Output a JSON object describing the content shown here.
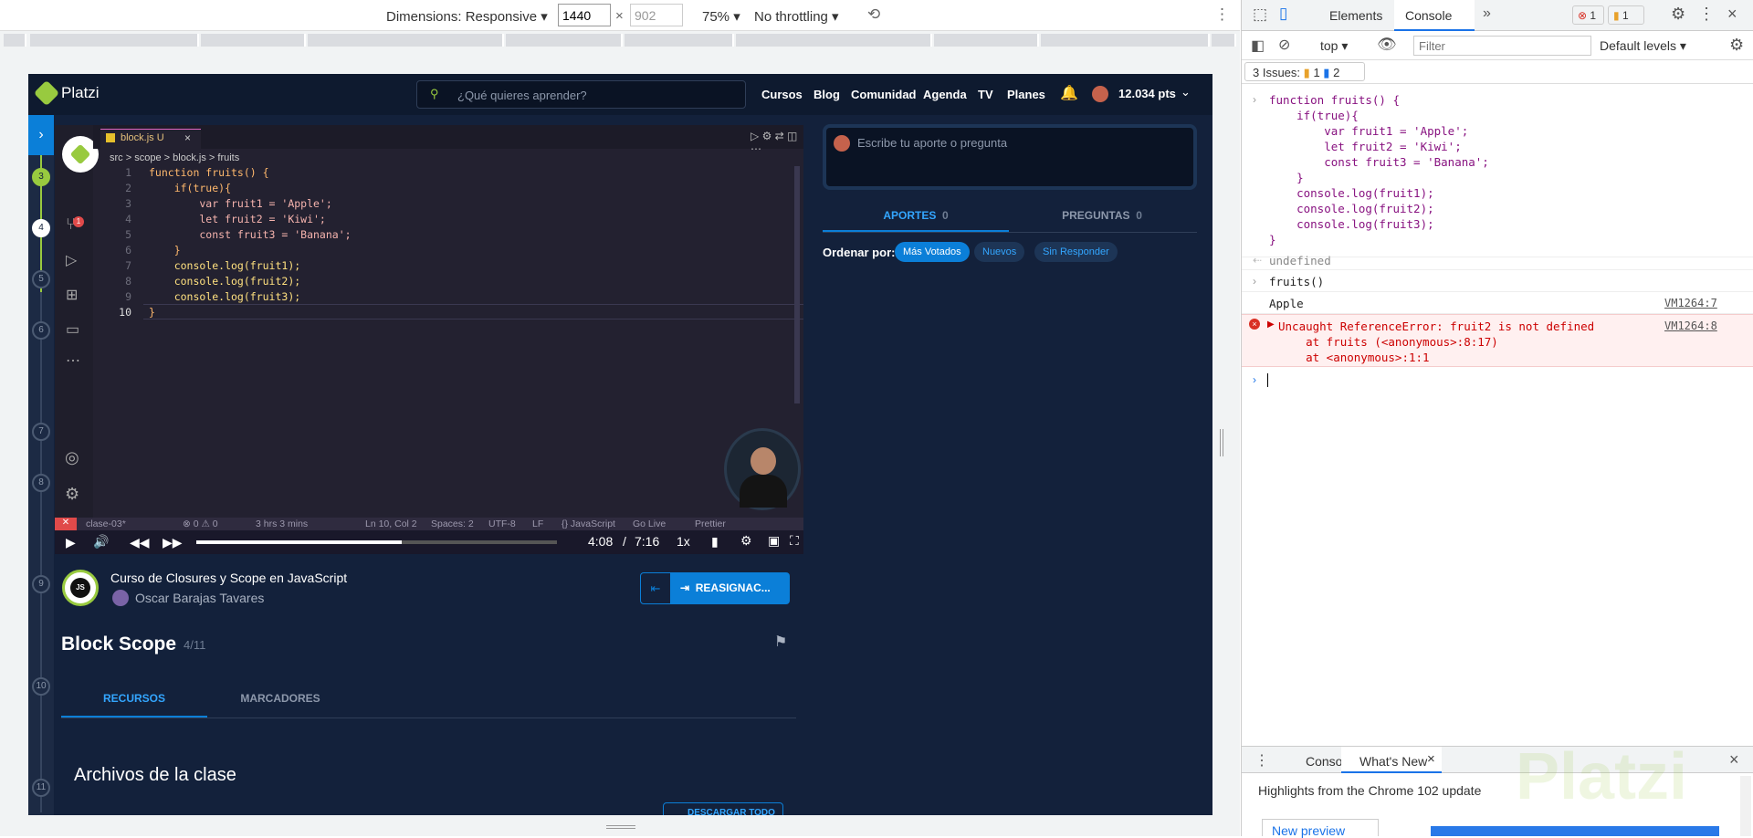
{
  "device_toolbar": {
    "dimensions": "Dimensions: Responsive",
    "width": "1440",
    "x": "×",
    "height": "902",
    "zoom": "75%",
    "throttle": "No throttling"
  },
  "platzi": {
    "logo": "Platzi",
    "search_placeholder": "¿Qué quieres aprender?",
    "nav": [
      "Cursos",
      "Blog",
      "Comunidad",
      "Agenda",
      "TV",
      "Planes"
    ],
    "points": "12.034 pts"
  },
  "steps": [
    "3",
    "4",
    "5",
    "6",
    "7",
    "8",
    "9",
    "10",
    "11"
  ],
  "editor": {
    "tab": "block.js U",
    "breadcrumb": [
      "src",
      ">",
      "scope",
      ">",
      "block.js",
      ">",
      "fruits"
    ],
    "line_numbers": [
      "1",
      "2",
      "3",
      "4",
      "5",
      "6",
      "7",
      "8",
      "9",
      "10"
    ],
    "notif": "1",
    "status": {
      "branch": "clase-03*",
      "errors": "⊗ 0 ⚠ 0",
      "time": "3 hrs 3 mins",
      "pos": "Ln 10, Col 2",
      "spaces": "Spaces: 2",
      "enc": "UTF-8",
      "eol": "LF",
      "lang": "{} JavaScript",
      "live": "Go Live",
      "prettier": "Prettier"
    }
  },
  "player": {
    "time_current": "4:08",
    "time_sep": "/",
    "time_total": "7:16",
    "speed": "1x",
    "progress": 0.57
  },
  "course": {
    "title": "Curso de Closures y Scope en JavaScript",
    "teacher": "Oscar Barajas Tavares",
    "badge": "JS",
    "reassign": "REASIGNAC..."
  },
  "lesson": {
    "title": "Block Scope",
    "count": "4/11",
    "tabs": [
      "RECURSOS",
      "MARCADORES"
    ],
    "files_title": "Archivos de la clase",
    "download": "DESCARGAR TODO"
  },
  "side": {
    "comment_placeholder": "Escribe tu aporte o pregunta",
    "tab_aportes": "APORTES",
    "aportes_count": "0",
    "tab_preguntas": "PREGUNTAS",
    "preguntas_count": "0",
    "order_label": "Ordenar por:",
    "chips": [
      "Más Votados",
      "Nuevos",
      "Sin Responder"
    ]
  },
  "devtools": {
    "tabs": [
      "Elements",
      "Console"
    ],
    "err_count": "1",
    "warn_count": "1",
    "context": "top",
    "filter_placeholder": "Filter",
    "levels": "Default levels",
    "issues_label": "3 Issues:",
    "issues_warn": "1",
    "issues_info": "2",
    "console_input": [
      "function fruits() {",
      "    if(true){",
      "        var fruit1 = 'Apple';",
      "        let fruit2 = 'Kiwi';",
      "        const fruit3 = 'Banana';",
      "    }",
      "    console.log(fruit1);",
      "    console.log(fruit2);",
      "    console.log(fruit3);",
      "}"
    ],
    "undefined": "undefined",
    "call": "fruits()",
    "apple": "Apple",
    "src1": "VM1264:7",
    "error": "Uncaught ReferenceError: fruit2 is not defined",
    "err2": "    at fruits (<anonymous>:8:17)",
    "err3": "    at <anonymous>:1:1",
    "src2": "VM1264:8",
    "drawer_tabs": [
      "Console",
      "What's New"
    ],
    "highlights": "Highlights from the Chrome 102 update",
    "new_preview": "New preview",
    "watermark": "Platzi"
  }
}
